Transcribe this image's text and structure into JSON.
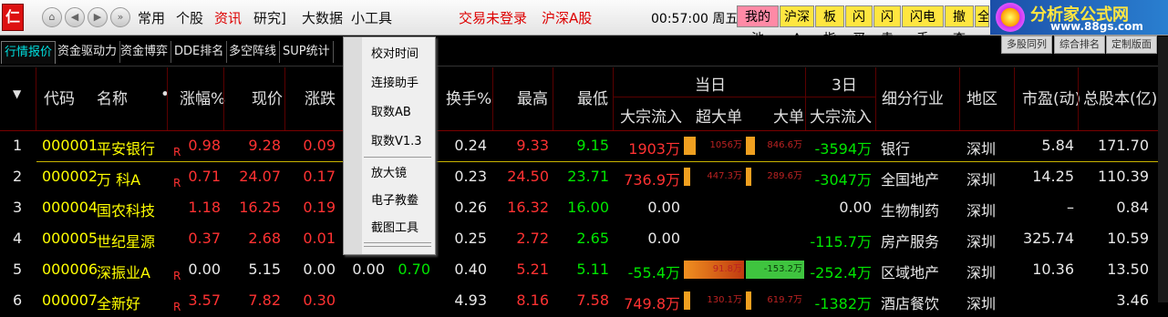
{
  "toolbar": {
    "logo": "仁",
    "menus": [
      "常用",
      "个股",
      "资讯",
      "研究]",
      "大数据",
      "小工具"
    ],
    "active_menu": "资讯",
    "status_login": "交易未登录",
    "status_market": "沪深A股",
    "time": "00:57:00",
    "weekday": "周五",
    "quick_buttons": [
      "我的池",
      "沪深A",
      "板指",
      "闪买",
      "闪卖",
      "闪电手",
      "撤查",
      "全"
    ],
    "brand_name": "分析家公式网",
    "brand_url": "www.88gs.com"
  },
  "tabs": [
    "行情报价",
    "资金驱动力",
    "资金博弈",
    "DDE排名",
    "多空阵线",
    "SUP统计"
  ],
  "right_tabs": [
    "多股同列",
    "综合排名",
    "定制版面"
  ],
  "dropdown": {
    "group1": [
      "校对时间",
      "连接助手",
      "取数AB",
      "取数V1.3"
    ],
    "group2": [
      "放大镜",
      "电子教鲞",
      "截图工具"
    ]
  },
  "header": {
    "sort_icon": "▼",
    "code": "代码",
    "name": "名称",
    "name_dot": "•",
    "change_pct": "涨幅%",
    "price": "现价",
    "change": "涨跌",
    "turnover": "换手%",
    "high": "最高",
    "low": "最低",
    "today": "当日",
    "block_in": "大宗流入",
    "super_large": "超大单",
    "large": "大单",
    "three_day": "3日",
    "block_in_3d": "大宗流入",
    "industry": "细分行业",
    "region": "地区",
    "pe": "市盈(动)",
    "total_shares": "总股本(亿)"
  },
  "rows": [
    {
      "idx": "1",
      "code": "000001",
      "name": "平安银行",
      "flag": "R",
      "chg_pct": "0.98",
      "price": "9.28",
      "chg": "0.09",
      "buy": "",
      "sell": "",
      "turnover": "0.24",
      "high": "9.33",
      "low": "9.15",
      "block_in": "1903万",
      "super": "1056万",
      "large": "846.6万",
      "super_bar": 0.2,
      "large_bar": 0.15,
      "block3": "-3594万",
      "industry": "银行",
      "region": "深圳",
      "pe": "5.84",
      "shares": "171.70",
      "price_color": "red",
      "low_color": "green",
      "block_color": "red",
      "bar_color": "orange"
    },
    {
      "idx": "2",
      "code": "000002",
      "name": "万 科A",
      "flag": "R",
      "chg_pct": "0.71",
      "price": "24.07",
      "chg": "0.17",
      "buy": "",
      "sell": "",
      "turnover": "0.23",
      "high": "24.50",
      "low": "23.71",
      "block_in": "736.9万",
      "super": "447.3万",
      "large": "289.6万",
      "super_bar": 0,
      "large_bar": 0,
      "block3": "-3047万",
      "industry": "全国地产",
      "region": "深圳",
      "pe": "14.25",
      "shares": "110.39",
      "price_color": "red",
      "low_color": "green",
      "block_color": "red",
      "bar_color": "orange"
    },
    {
      "idx": "3",
      "code": "000004",
      "name": "国农科技",
      "flag": "",
      "chg_pct": "1.18",
      "price": "16.25",
      "chg": "0.19",
      "buy": "",
      "sell": "",
      "turnover": "0.26",
      "high": "16.32",
      "low": "16.00",
      "block_in": "0.00",
      "super": "",
      "large": "",
      "super_bar": 0,
      "large_bar": 0,
      "block3": "0.00",
      "industry": "生物制药",
      "region": "深圳",
      "pe": "–",
      "shares": "0.84",
      "price_color": "red",
      "low_color": "green",
      "block_color": "white",
      "bar_color": "orange"
    },
    {
      "idx": "4",
      "code": "000005",
      "name": "世纪星源",
      "flag": "",
      "chg_pct": "0.37",
      "price": "2.68",
      "chg": "0.01",
      "buy": "",
      "sell": "",
      "turnover": "0.25",
      "high": "2.72",
      "low": "2.65",
      "block_in": "0.00",
      "super": "",
      "large": "",
      "super_bar": 0,
      "large_bar": 0,
      "block3": "-115.7万",
      "industry": "房产服务",
      "region": "深圳",
      "pe": "325.74",
      "shares": "10.59",
      "price_color": "red",
      "low_color": "green",
      "block_color": "white",
      "bar_color": "orange"
    },
    {
      "idx": "5",
      "code": "000006",
      "name": "深振业A",
      "flag": "R",
      "chg_pct": "0.00",
      "price": "5.15",
      "chg": "0.00",
      "buy": "0.00",
      "sell": "0.70",
      "turnover": "0.40",
      "high": "5.21",
      "low": "5.11",
      "block_in": "-55.4万",
      "super": "91.8万",
      "large": "-153.2万",
      "super_bar": 1,
      "large_bar": 1,
      "block3": "-252.4万",
      "industry": "区域地产",
      "region": "深圳",
      "pe": "10.36",
      "shares": "13.50",
      "price_color": "white",
      "low_color": "green",
      "block_color": "green",
      "bar_color": "orange"
    },
    {
      "idx": "6",
      "code": "000007",
      "name": "全新好",
      "flag": "R",
      "chg_pct": "3.57",
      "price": "7.82",
      "chg": "0.30",
      "buy": "",
      "sell": "",
      "turnover": "4.93",
      "high": "8.16",
      "low": "7.58",
      "block_in": "749.8万",
      "super": "130.1万",
      "large": "619.7万",
      "super_bar": 0,
      "large_bar": 0,
      "block3": "-1382万",
      "industry": "酒店餐饮",
      "region": "深圳",
      "pe": "",
      "shares": "3.46",
      "price_color": "red",
      "low_color": "red",
      "block_color": "red",
      "bar_color": "orange"
    }
  ]
}
